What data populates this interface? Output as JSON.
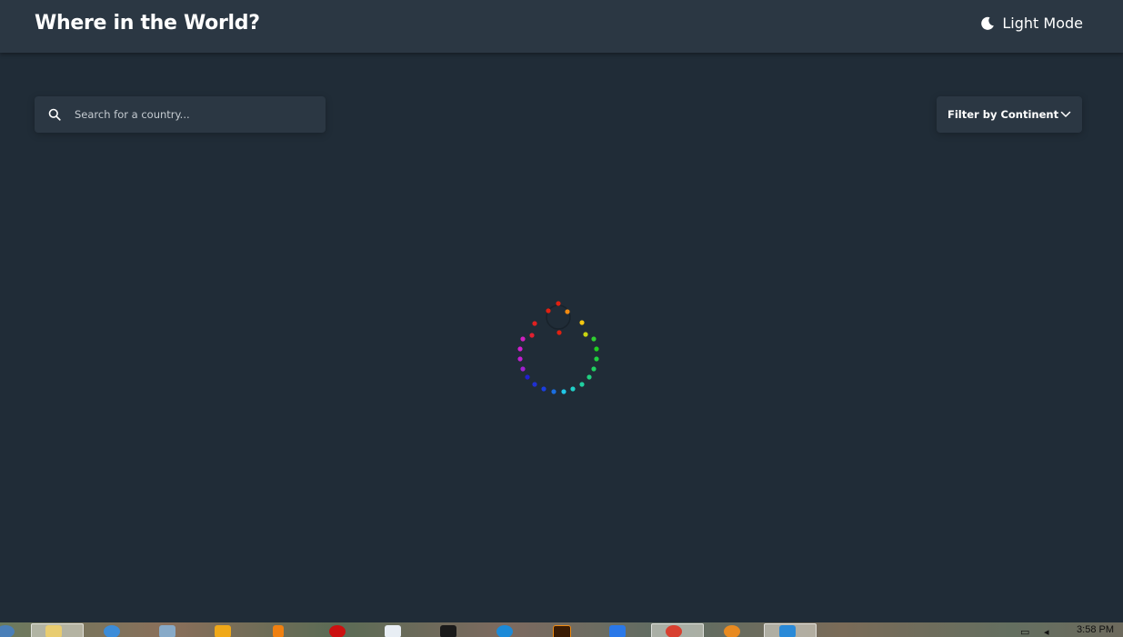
{
  "header": {
    "title": "Where in the World?",
    "theme_toggle_label": "Light Mode"
  },
  "search": {
    "placeholder": "Search for a country...",
    "value": ""
  },
  "filter": {
    "label": "Filter by Continent"
  },
  "colors": {
    "background": "#202c37",
    "surface": "#2b3743",
    "text": "#ffffff"
  },
  "loader": {
    "icon": "rainbow-dot-spinner"
  },
  "taskbar": {
    "clock": "3:58 PM",
    "apps": [
      "start-icon",
      "file-explorer-icon",
      "internet-explorer-icon",
      "media-app-icon",
      "messenger-icon",
      "vlc-icon",
      "opera-icon",
      "document-icon",
      "command-prompt-icon",
      "edge-icon",
      "illustrator-icon",
      "blue-app-icon",
      "chrome-icon",
      "firefox-icon",
      "vscode-icon"
    ]
  }
}
